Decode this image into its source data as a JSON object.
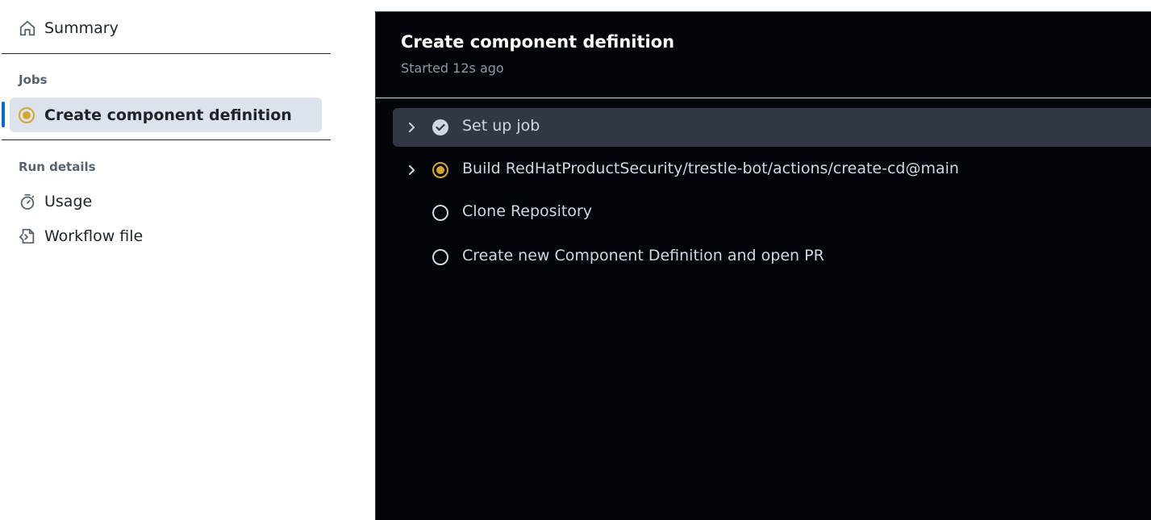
{
  "sidebar": {
    "summary_label": "Summary",
    "jobs_heading": "Jobs",
    "active_job_label": "Create component definition",
    "run_details_heading": "Run details",
    "usage_label": "Usage",
    "workflow_file_label": "Workflow file"
  },
  "job": {
    "title": "Create component definition",
    "status_text": "Started 12s ago",
    "steps": [
      {
        "label": "Set up job",
        "status": "success"
      },
      {
        "label": "Build RedHatProductSecurity/trestle-bot/actions/create-cd@main",
        "status": "in_progress"
      },
      {
        "label": "Clone Repository",
        "status": "pending"
      },
      {
        "label": "Create new Component Definition and open PR",
        "status": "pending"
      }
    ]
  },
  "colors": {
    "in_progress": "#d4a72c",
    "accent_bar": "#0969da",
    "panel_bg": "#010409"
  }
}
